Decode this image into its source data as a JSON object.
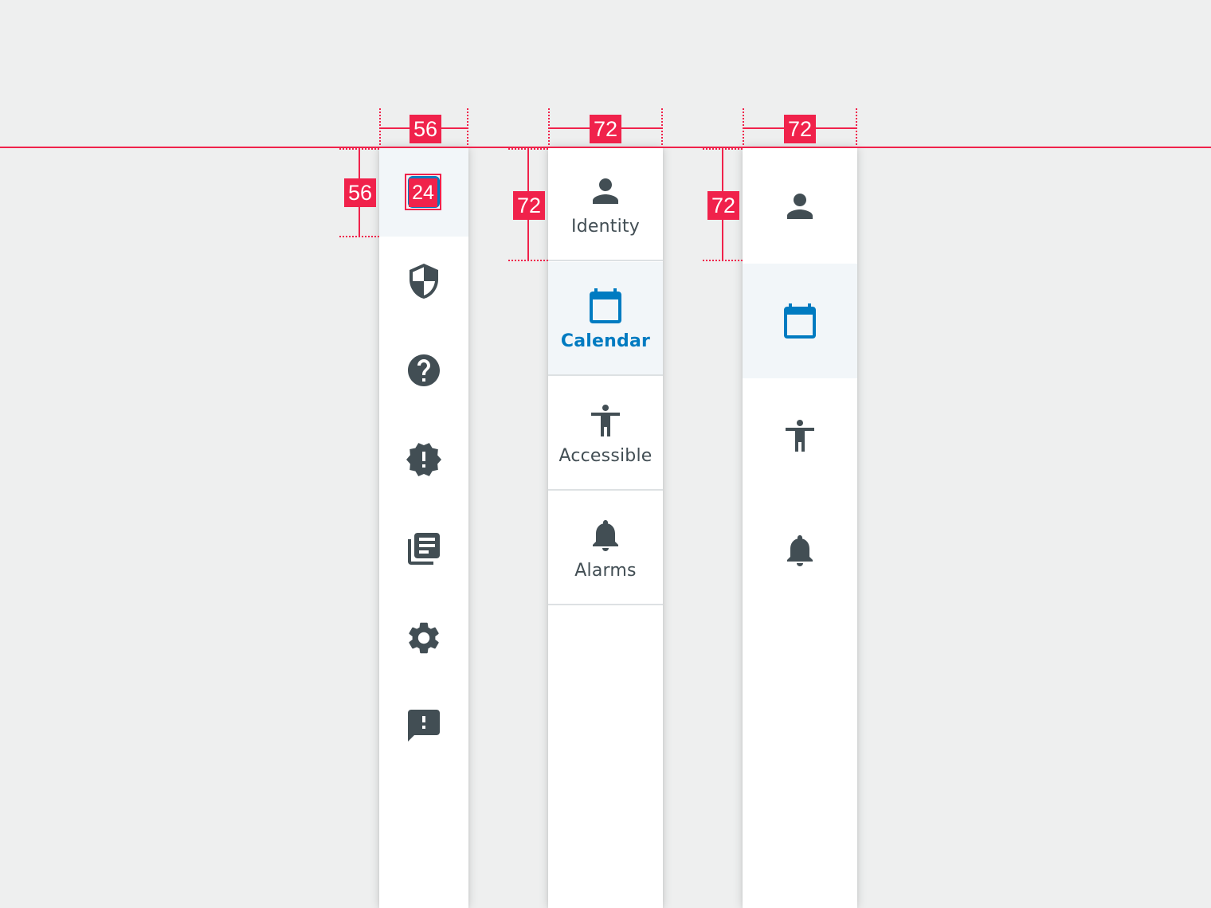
{
  "colors": {
    "background": "#eeefef",
    "rail": "#ffffff",
    "selected_bg": "#f2f6f9",
    "icon": "#424e54",
    "accent": "#007bc1",
    "redline": "#f0224b",
    "divider": "#dde1e3"
  },
  "redlines": {
    "compact_width": "56",
    "compact_height": "56",
    "icon_size": "24",
    "labeled_width": "72",
    "labeled_height": "72",
    "icons_width": "72",
    "icons_height": "72"
  },
  "compact_rail": {
    "items": [
      {
        "icon": "account-icon",
        "selected": true
      },
      {
        "icon": "security-shield-icon",
        "selected": false
      },
      {
        "icon": "help-icon",
        "selected": false
      },
      {
        "icon": "new-releases-icon",
        "selected": false
      },
      {
        "icon": "library-books-icon",
        "selected": false
      },
      {
        "icon": "settings-icon",
        "selected": false
      },
      {
        "icon": "feedback-icon",
        "selected": false
      }
    ]
  },
  "labeled_rail": {
    "items": [
      {
        "label": "Identity",
        "icon": "person-icon",
        "selected": false
      },
      {
        "label": "Calendar",
        "icon": "calendar-icon",
        "selected": true
      },
      {
        "label": "Accessible",
        "icon": "accessibility-icon",
        "selected": false
      },
      {
        "label": "Alarms",
        "icon": "bell-icon",
        "selected": false
      }
    ]
  },
  "icon_rail": {
    "items": [
      {
        "icon": "person-icon",
        "selected": false
      },
      {
        "icon": "calendar-icon",
        "selected": true
      },
      {
        "icon": "accessibility-icon",
        "selected": false
      },
      {
        "icon": "bell-icon",
        "selected": false
      }
    ]
  }
}
